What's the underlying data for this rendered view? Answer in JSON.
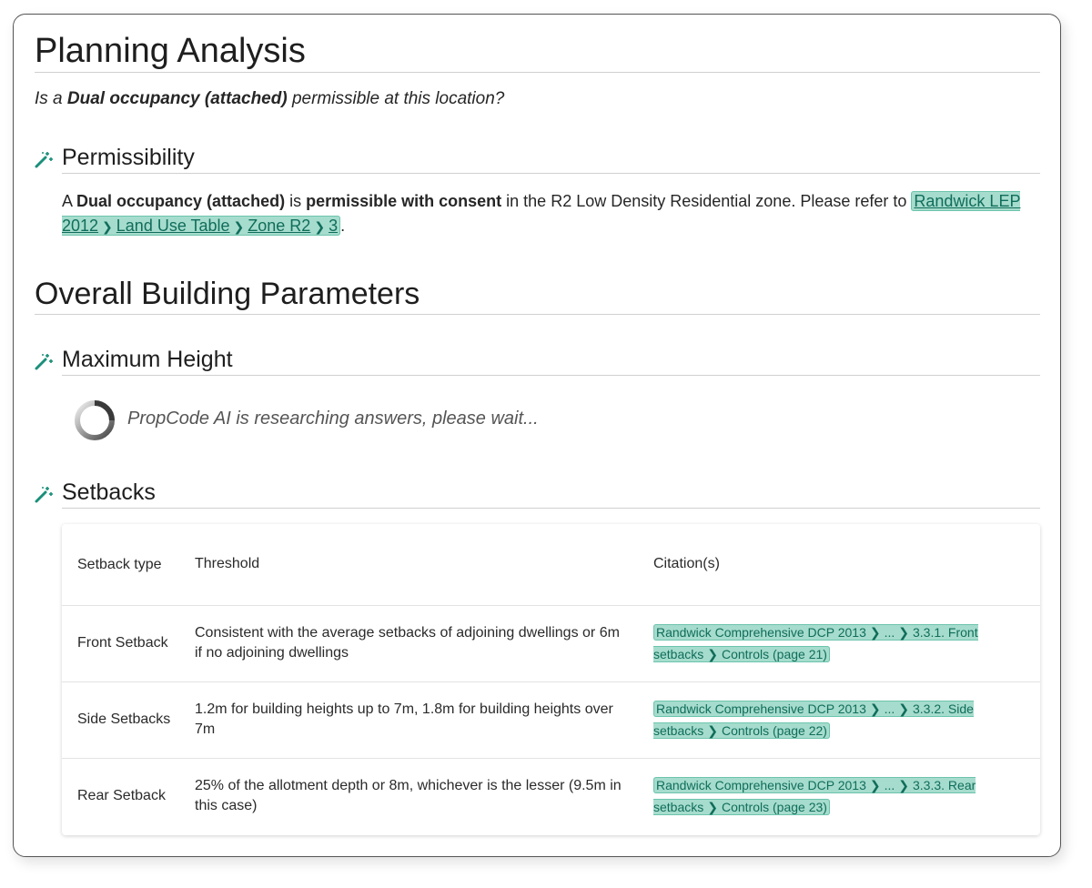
{
  "page": {
    "title": "Planning Analysis",
    "question": {
      "prefix": "Is a ",
      "use_type": "Dual occupancy (attached)",
      "suffix": " permissible at this location?"
    }
  },
  "permissibility": {
    "heading": "Permissibility",
    "icon": "magic-wand-icon",
    "text_a": "A ",
    "use_type": "Dual occupancy (attached)",
    "text_is": " is ",
    "status": "permissible with consent",
    "text_rest": " in the R2 Low Density Residential zone. Please refer to ",
    "citation": [
      "Randwick LEP 2012",
      "Land Use Table",
      "Zone R2",
      "3"
    ],
    "text_end": "."
  },
  "overall": {
    "heading": "Overall Building Parameters"
  },
  "max_height": {
    "heading": "Maximum Height",
    "icon": "magic-wand-icon",
    "loading_text": "PropCode AI is researching answers, please wait..."
  },
  "setbacks": {
    "heading": "Setbacks",
    "icon": "magic-wand-icon",
    "columns": [
      "Setback type",
      "Threshold",
      "Citation(s)"
    ],
    "rows": [
      {
        "type": "Front Setback",
        "threshold": "Consistent with the average setbacks of adjoining dwellings or 6m if no adjoining dwellings",
        "citation": [
          "Randwick Comprehensive DCP 2013",
          "...",
          "3.3.1. Front setbacks",
          "Controls (page 21)"
        ]
      },
      {
        "type": "Side Setbacks",
        "threshold": "1.2m for building heights up to 7m, 1.8m for building heights over 7m",
        "citation": [
          "Randwick Comprehensive DCP 2013",
          "...",
          "3.3.2. Side setbacks",
          "Controls (page 22)"
        ]
      },
      {
        "type": "Rear Setback",
        "threshold": "25% of the allotment depth or 8m, whichever is the lesser (9.5m in this case)",
        "citation": [
          "Randwick Comprehensive DCP 2013",
          "...",
          "3.3.3. Rear setbacks",
          "Controls (page 23)"
        ]
      }
    ]
  },
  "colors": {
    "citation_bg": "#a6dccd",
    "citation_text": "#106d5b",
    "icon_teal": "#1a8f7a"
  }
}
